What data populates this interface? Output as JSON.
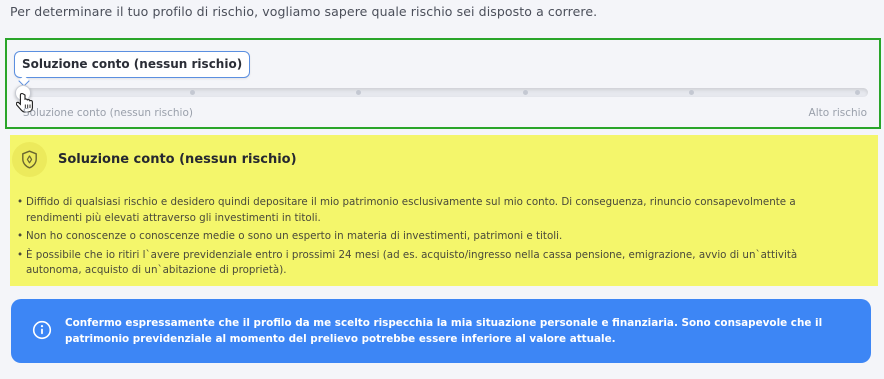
{
  "intro_text": "Per determinare il tuo profilo di rischio, vogliamo sapere quale rischio sei disposto a correre.",
  "slider": {
    "tooltip": "Soluzione conto (nessun rischio)",
    "min_label": "Soluzione conto (nessun rischio)",
    "max_label": "Alto rischio",
    "steps": 6,
    "selected_step": 0,
    "accent": "#5b8fe0",
    "highlight_border": "#2aa52a"
  },
  "profile": {
    "icon": "shield-icon",
    "title": "Soluzione conto (nessun rischio)",
    "background": "#f4f66b",
    "bullets": [
      "Diffido di qualsiasi rischio e desidero quindi depositare il mio patrimonio esclusivamente sul mio conto. Di conseguenza, rinuncio consapevolmente a rendimenti più elevati attraverso gli investimenti in titoli.",
      "Non ho conoscenze o conoscenze medie o sono un esperto in materia di investimenti, patrimoni e titoli.",
      "È possibile che io ritiri l`avere previdenziale entro i prossimi 24 mesi (ad es. acquisto/ingresso nella cassa pensione, emigrazione, avvio di un`attività autonoma, acquisto di un`abitazione di proprietà)."
    ]
  },
  "confirmation": {
    "icon": "info-icon",
    "text": "Confermo espressamente che il profilo da me scelto rispecchia la mia situazione personale e finanziaria. Sono consapevole che il patrimonio previdenziale al momento del prelievo potrebbe essere inferiore al valore attuale.",
    "background": "#3d86f5"
  }
}
